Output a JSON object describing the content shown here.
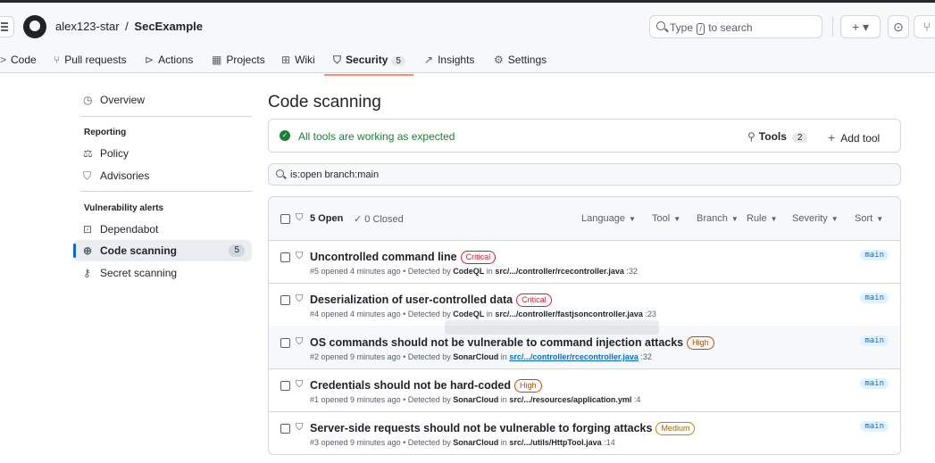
{
  "header": {
    "owner": "alex123-star",
    "separator": "/",
    "repo": "SecExample",
    "search_prefix": "Type",
    "search_key": "/",
    "search_suffix": "to search",
    "plus_label": "+ ▾"
  },
  "tabs": [
    {
      "icon": "<>",
      "label": "Code"
    },
    {
      "icon": "⑂",
      "label": "Pull requests"
    },
    {
      "icon": "▶",
      "label": "Actions"
    },
    {
      "icon": "▦",
      "label": "Projects"
    },
    {
      "icon": "📖",
      "label": "Wiki"
    },
    {
      "icon": "⛉",
      "label": "Security",
      "count": "5"
    },
    {
      "icon": "↗",
      "label": "Insights"
    },
    {
      "icon": "⚙",
      "label": "Settings"
    }
  ],
  "sidebar": {
    "overview": "Overview",
    "reporting_heading": "Reporting",
    "policy": "Policy",
    "advisories": "Advisories",
    "vuln_heading": "Vulnerability alerts",
    "dependabot": "Dependabot",
    "code_scanning": "Code scanning",
    "code_scanning_count": "5",
    "secret_scanning": "Secret scanning"
  },
  "main": {
    "title": "Code scanning",
    "status_message": "All tools are working as expected",
    "tools_label": "Tools",
    "tools_count": "2",
    "add_tool_label": "Add tool",
    "filter_value": "is:open branch:main"
  },
  "list_header": {
    "open_label": "5 Open",
    "closed_label": "0 Closed",
    "filters": [
      "Language",
      "Tool",
      "Branch",
      "Rule",
      "Severity",
      "Sort"
    ]
  },
  "alerts": [
    {
      "title": "Uncontrolled command line",
      "severity": "Critical",
      "meta_prefix": "#5 opened 4 minutes ago • Detected by",
      "tool": "CodeQL",
      "in": "in",
      "path": "src/.../controller/rcecontroller.java",
      "line": ":32",
      "branch": "main"
    },
    {
      "title": "Deserialization of user-controlled data",
      "severity": "Critical",
      "meta_prefix": "#4 opened 4 minutes ago • Detected by",
      "tool": "CodeQL",
      "in": "in",
      "path": "src/.../controller/fastjsoncontroller.java",
      "line": ":23",
      "branch": "main"
    },
    {
      "title": "OS commands should not be vulnerable to command injection attacks",
      "severity": "High",
      "meta_prefix": "#2 opened 9 minutes ago • Detected by",
      "tool": "SonarCloud",
      "in": "in",
      "path": "src/.../controller/rcecontroller.java",
      "line": ":32",
      "branch": "main"
    },
    {
      "title": "Credentials should not be hard-coded",
      "severity": "High",
      "meta_prefix": "#1 opened 9 minutes ago • Detected by",
      "tool": "SonarCloud",
      "in": "in",
      "path": "src/.../resources/application.yml",
      "line": ":4",
      "branch": "main"
    },
    {
      "title": "Server-side requests should not be vulnerable to forging attacks",
      "severity": "Medium",
      "meta_prefix": "#3 opened 9 minutes ago • Detected by",
      "tool": "SonarCloud",
      "in": "in",
      "path": "src/.../utils/HttpTool.java",
      "line": ":14",
      "branch": "main"
    }
  ]
}
